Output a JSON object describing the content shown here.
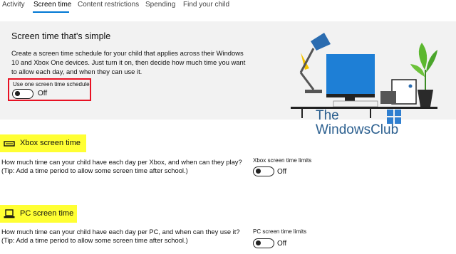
{
  "tabs": [
    {
      "label": "Activity"
    },
    {
      "label": "Screen time"
    },
    {
      "label": "Content restrictions"
    },
    {
      "label": "Spending"
    },
    {
      "label": "Find your child"
    }
  ],
  "hero": {
    "title": "Screen time that's simple",
    "description": "Create a screen time schedule for your child that applies across their Windows 10 and Xbox One devices. Just turn it on, then decide how much time you want to allow each day, and when they can use it.",
    "schedule_label": "Use one screen time schedule",
    "schedule_state": "Off"
  },
  "watermark": {
    "line1": "The",
    "line2": "WindowsClub"
  },
  "xbox": {
    "heading": "Xbox screen time",
    "question": "How much time can your child have each day per Xbox, and when can they play?",
    "tip": "(Tip: Add a time period to allow some screen time after school.)",
    "limit_label": "Xbox screen time limits",
    "state": "Off"
  },
  "pc": {
    "heading": "PC screen time",
    "question": "How much time can your child have each day per PC, and when can they use it?",
    "tip": "(Tip: Add a time period to allow some screen time after school.)",
    "limit_label": "PC screen time limits",
    "state": "Off"
  },
  "colors": {
    "accent": "#0078d4",
    "highlight": "#ffff33",
    "alert_border": "#e81123",
    "hero_bg": "#f2f2f2"
  }
}
